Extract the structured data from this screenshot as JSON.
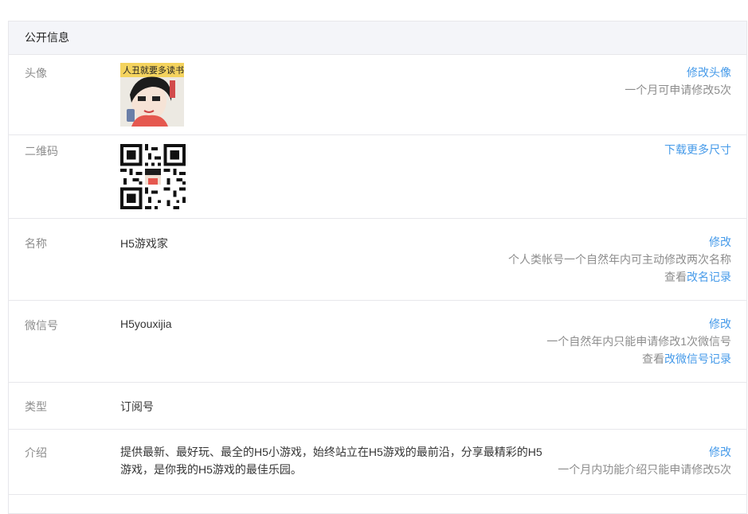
{
  "panel": {
    "title": "公开信息"
  },
  "avatar": {
    "label": "头像",
    "action": "修改头像",
    "note": "一个月可申请修改5次",
    "image_text": "人丑就要多读书"
  },
  "qrcode": {
    "label": "二维码",
    "action": "下载更多尺寸"
  },
  "name": {
    "label": "名称",
    "value": "H5游戏家",
    "action": "修改",
    "note": "个人类帐号一个自然年内可主动修改两次名称",
    "history_prefix": "查看",
    "history_link": "改名记录"
  },
  "wechat_id": {
    "label": "微信号",
    "value": "H5youxijia",
    "action": "修改",
    "note": "一个自然年内只能申请修改1次微信号",
    "history_prefix": "查看",
    "history_link": "改微信号记录"
  },
  "type": {
    "label": "类型",
    "value": "订阅号"
  },
  "intro": {
    "label": "介绍",
    "value": "提供最新、最好玩、最全的H5小游戏，始终站立在H5游戏的最前沿，分享最精彩的H5游戏，是你我的H5游戏的最佳乐园。",
    "action": "修改",
    "note": "一个月内功能介绍只能申请修改5次"
  },
  "colors": {
    "link": "#459ae9",
    "label": "#8d8d8d",
    "border": "#e7e7eb",
    "header_bg": "#f4f5f9"
  }
}
